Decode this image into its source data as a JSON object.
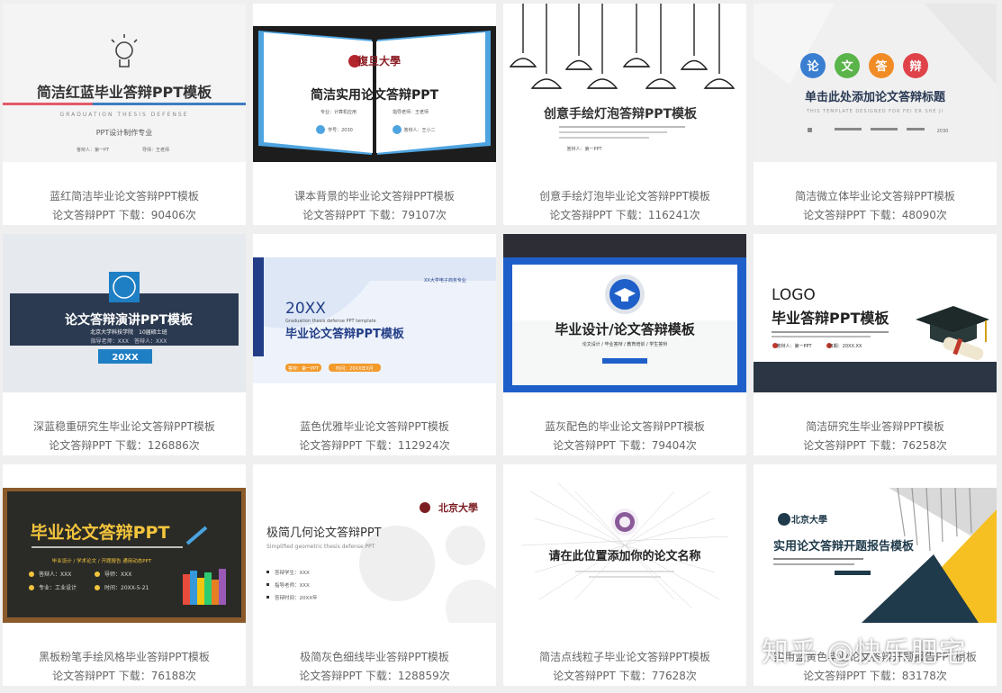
{
  "cards": [
    {
      "title": "蓝红简洁毕业论文答辩PPT模板",
      "category": "论文答辩PPT",
      "downloads_label": "下载：90406次",
      "thumb": {
        "heading": "简洁红蓝毕业答辩PPT模板",
        "subheading": "GRADUATION THESIS DEFENSE",
        "line1": "PPT设计制作专业",
        "line2": "答辩人：第一PT",
        "line3": "导师：王老师"
      }
    },
    {
      "title": "课本背景的毕业论文答辩PPT模板",
      "category": "论文答辩PPT",
      "downloads_label": "下载：79107次",
      "thumb": {
        "logo": "復旦大學",
        "heading": "简洁实用论文答辩PPT",
        "line1": "专业：计算机应用",
        "line2": "指导老师：王老师",
        "line3": "学号：2030",
        "line4": "答辩人：王小二"
      }
    },
    {
      "title": "创意手绘灯泡毕业论文答辩PPT模板",
      "category": "论文答辩PPT",
      "downloads_label": "下载：116241次",
      "thumb": {
        "heading": "创意手绘灯泡答辩PPT模板",
        "line1": "答辩人：第一PPT"
      }
    },
    {
      "title": "简洁微立体毕业论文答辩PPT模板",
      "category": "论文答辩PPT",
      "downloads_label": "下载：48090次",
      "thumb": {
        "bubbles": [
          "论",
          "文",
          "答",
          "辩"
        ],
        "heading": "单击此处添加论文答辩标题",
        "subheading": "THIS TEMPLATE DESIGNED FOR FEI ER SHE JI",
        "line1": "2030"
      }
    },
    {
      "title": "深蓝稳重研究生毕业论文答辩PPT模板",
      "category": "论文答辩PPT",
      "downloads_label": "下载：126886次",
      "thumb": {
        "heading": "论文答辩演讲PPT模板",
        "line1": "北京大学科技学院　10届硕士班",
        "line2": "指导老师：XXX　答辩人：XXX",
        "line3": "20XX"
      }
    },
    {
      "title": "蓝色优雅毕业论文答辩PPT模板",
      "category": "论文答辩PPT",
      "downloads_label": "下载：112924次",
      "thumb": {
        "year": "20XX",
        "heading": "毕业论文答辩PPT模板",
        "line1": "XX大学电子商务专业",
        "line2": "Graduation thesis defense PPT template",
        "line3": "答辩：第一PPT",
        "line4": "时间：20XX年X月"
      }
    },
    {
      "title": "蓝灰配色的毕业论文答辩PPT模板",
      "category": "论文答辩PPT",
      "downloads_label": "下载：79404次",
      "thumb": {
        "heading": "毕业设计/论文答辩模板",
        "line1": "论文设计 / 毕业答辩 / 教育培训 / 学生答辩"
      }
    },
    {
      "title": "简洁研究生毕业答辩PPT模板",
      "category": "论文答辩PPT",
      "downloads_label": "下载：76258次",
      "thumb": {
        "logo": "LOGO",
        "heading": "毕业答辩PPT模板",
        "line1": "答辩人：第一PPT",
        "line2": "日期：20XX.XX"
      }
    },
    {
      "title": "黑板粉笔手绘风格毕业答辩PPT模板",
      "category": "论文答辩PPT",
      "downloads_label": "下载：76188次",
      "thumb": {
        "heading": "毕业论文答辩PPT",
        "line1": "毕业设计 / 学术论文 / 开题报告 通用动态PPT",
        "line2": "答辩人：XXX",
        "line3": "导师：XXX",
        "line4": "专业：工业设计",
        "line5": "时间：20XX-5-21"
      }
    },
    {
      "title": "极简灰色细线毕业答辩PPT模板",
      "category": "论文答辩PPT",
      "downloads_label": "下载：128859次",
      "thumb": {
        "logo": "北京大學",
        "heading": "极简几何论文答辩PPT",
        "subheading": "Simplified geometric thesis defense PPT",
        "line1": "答辩学生：XXX",
        "line2": "指导老师：XXX",
        "line3": "答辩时间：20XX年"
      }
    },
    {
      "title": "简洁点线粒子毕业论文答辩PPT模板",
      "category": "论文答辩PPT",
      "downloads_label": "下载：77628次",
      "thumb": {
        "heading": "请在此位置添加你的论文名称"
      }
    },
    {
      "title": "实用蓝黄色毕业论文答辩开题报告PPT模板",
      "category": "论文答辩PPT",
      "downloads_label": "下载：83178次",
      "thumb": {
        "logo": "北京大學",
        "heading": "实用论文答辩开题报告模板"
      }
    }
  ],
  "watermark": "知乎 @快乐肥宅",
  "colors": {
    "card_bg": "#ffffff",
    "page_bg": "#efefef",
    "caption": "#666666"
  }
}
